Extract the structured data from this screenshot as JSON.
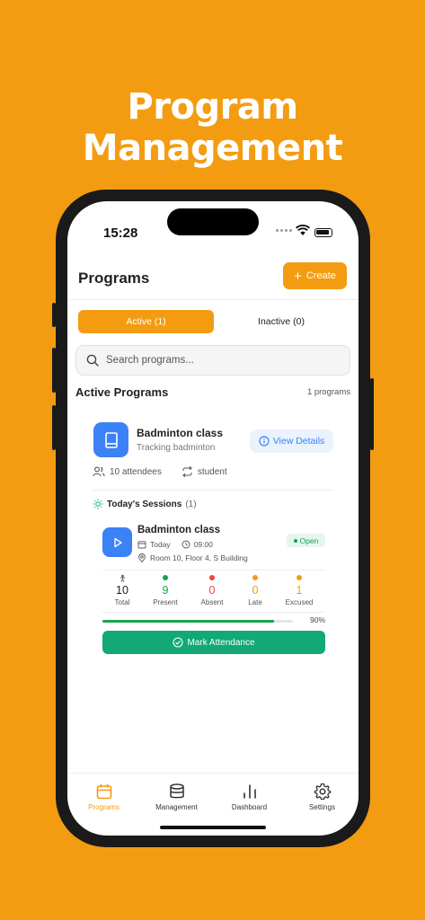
{
  "headline": "Program Management",
  "status_bar": {
    "time": "15:28"
  },
  "header": {
    "title": "Programs",
    "create_label": "Create"
  },
  "tabs": [
    {
      "label": "Active (1)",
      "active": true
    },
    {
      "label": "Inactive (0)",
      "active": false
    }
  ],
  "search": {
    "placeholder": "Search programs..."
  },
  "section": {
    "title": "Active Programs",
    "count": "1 programs"
  },
  "program": {
    "name": "Badminton class",
    "description": "Tracking badminton",
    "view_label": "View Details",
    "attendees": "10 attendees",
    "type": "student",
    "icon": "book-icon"
  },
  "today": {
    "title": "Today's Sessions",
    "count": "(1)"
  },
  "session": {
    "name": "Badminton class",
    "date": "Today",
    "time": "09:00",
    "location": "Room 10, Floor 4, S Building",
    "status": "Open",
    "stats": [
      {
        "value": "10",
        "label": "Total",
        "color": "#222222"
      },
      {
        "value": "9",
        "label": "Present",
        "color": "#16A34A"
      },
      {
        "value": "0",
        "label": "Absent",
        "color": "#EF4444"
      },
      {
        "value": "0",
        "label": "Late",
        "color": "#F39C12"
      },
      {
        "value": "1",
        "label": "Excused",
        "color": "#F39C12"
      }
    ],
    "progress_pct": 90,
    "progress_label": "90%",
    "mark_label": "Mark Attendance"
  },
  "bottom_nav": [
    {
      "label": "Programs",
      "icon": "calendar-icon",
      "active": true
    },
    {
      "label": "Management",
      "icon": "database-icon",
      "active": false
    },
    {
      "label": "Dashboard",
      "icon": "bar-chart-icon",
      "active": false
    },
    {
      "label": "Settings",
      "icon": "gear-icon",
      "active": false
    }
  ],
  "colors": {
    "accent": "#F39C12",
    "blue": "#3B82F6",
    "green": "#12A877"
  }
}
